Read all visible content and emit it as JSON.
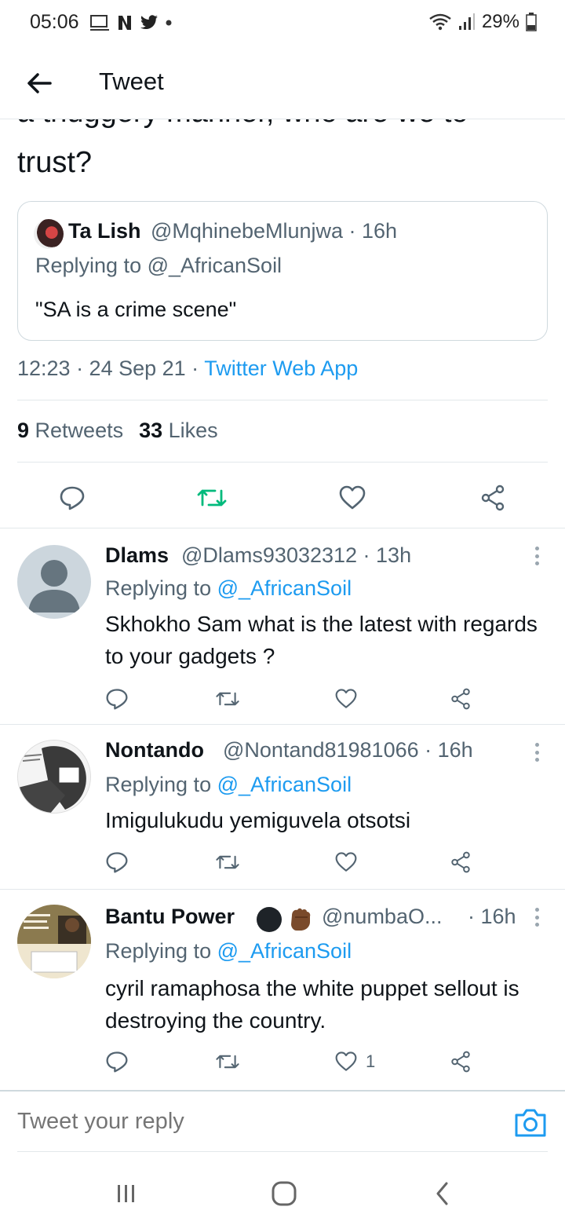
{
  "status_bar": {
    "time": "05:06",
    "battery": "29%",
    "left_icons": [
      "screen-cast-icon",
      "netflix-icon",
      "twitter-icon",
      "dot-icon"
    ],
    "right_icons": [
      "wifi-icon",
      "signal-icon",
      "battery-icon"
    ]
  },
  "header": {
    "title": "Tweet",
    "back_icon": "arrow-left-icon"
  },
  "main_tweet": {
    "text_clipped": "a thuggery manner, who are we to",
    "text_line2": "trust?",
    "quote": {
      "name": "Ta Lish",
      "handle": "@MqhinebeMlunjwa · 16h",
      "replying": "Replying to @_AfricanSoil",
      "text": "\"SA is a crime scene\""
    },
    "meta_time": "12:23 · 24 Sep 21 · ",
    "meta_source": "Twitter Web App",
    "retweets_count": "9",
    "retweets_label": " Retweets",
    "likes_count": "33",
    "likes_label": " Likes"
  },
  "replies": [
    {
      "name": "Dlams",
      "handle": "@Dlams93032312 · 13h",
      "replying_prefix": "Replying to ",
      "mention": "@_AfricanSoil",
      "text": "Skhokho Sam what is the latest with regards to your gadgets ?",
      "likes": ""
    },
    {
      "name": "Nontando",
      "handle": "@Nontand81981066 · 16h",
      "replying_prefix": "Replying to ",
      "mention": "@_AfricanSoil",
      "text": "Imigulukudu yemiguvela otsotsi",
      "likes": ""
    },
    {
      "name": "Bantu Power",
      "handle": "@numbaO...",
      "time": "· 16h",
      "replying_prefix": "Replying to ",
      "mention": "@_AfricanSoil",
      "text": "cyril ramaphosa the white puppet sellout is destroying the country.",
      "likes": "1"
    }
  ],
  "reply_box": {
    "placeholder": "Tweet your reply",
    "camera_icon": "camera-icon"
  },
  "nav_bar": [
    "recent-apps-icon",
    "home-icon",
    "back-icon"
  ],
  "colors": {
    "link": "#1d9bf0",
    "secondary_text": "#536471",
    "retweet_green": "#00ba7c",
    "divider": "#e3e8eb"
  }
}
